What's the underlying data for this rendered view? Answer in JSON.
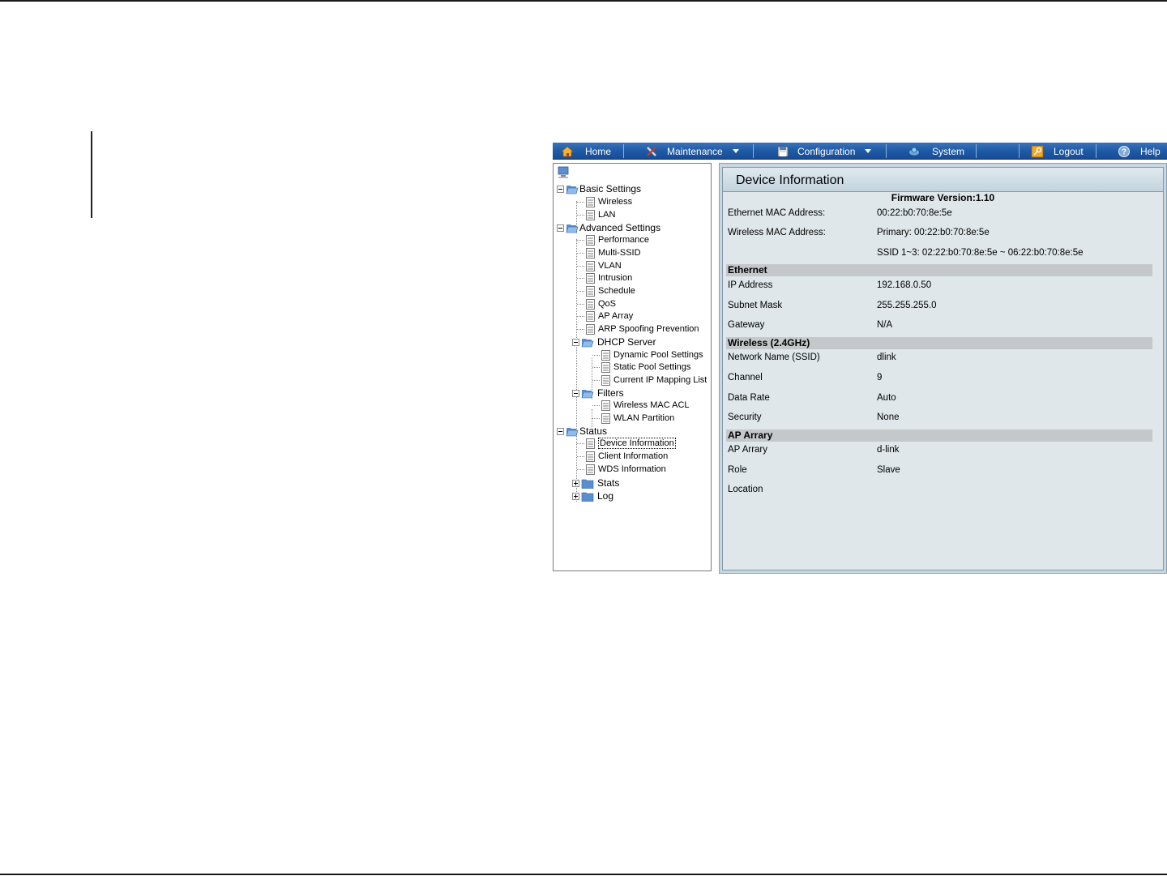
{
  "menu": {
    "home": "Home",
    "maintenance": "Maintenance",
    "configuration": "Configuration",
    "system": "System",
    "logout": "Logout",
    "help": "Help"
  },
  "tree": {
    "basic_settings": "Basic Settings",
    "wireless": "Wireless",
    "lan": "LAN",
    "advanced_settings": "Advanced Settings",
    "performance": "Performance",
    "multi_ssid": "Multi-SSID",
    "vlan": "VLAN",
    "intrusion": "Intrusion",
    "schedule": "Schedule",
    "qos": "QoS",
    "ap_array": "AP Array",
    "arp_spoofing": "ARP Spoofing Prevention",
    "dhcp_server": "DHCP Server",
    "dynamic_pool": "Dynamic Pool Settings",
    "static_pool": "Static Pool Settings",
    "ip_mapping": "Current IP Mapping List",
    "filters": "Filters",
    "wireless_mac_acl": "Wireless MAC ACL",
    "wlan_partition": "WLAN Partition",
    "status": "Status",
    "device_information": "Device Information",
    "client_information": "Client Information",
    "wds_information": "WDS Information",
    "stats": "Stats",
    "log": "Log"
  },
  "panel": {
    "title": "Device Information",
    "firmware": "Firmware Version:1.10",
    "ethernet_mac_label": "Ethernet MAC Address:",
    "ethernet_mac_value": "00:22:b0:70:8e:5e",
    "wireless_mac_label": "Wireless MAC Address:",
    "wireless_mac_primary": "Primary: 00:22:b0:70:8e:5e",
    "wireless_mac_ssid": "SSID 1~3: 02:22:b0:70:8e:5e ~ 06:22:b0:70:8e:5e",
    "ethernet_section": "Ethernet",
    "ip_label": "IP Address",
    "ip_value": "192.168.0.50",
    "subnet_label": "Subnet Mask",
    "subnet_value": "255.255.255.0",
    "gateway_label": "Gateway",
    "gateway_value": "N/A",
    "wireless_section": "Wireless (2.4GHz)",
    "ssid_label": "Network Name (SSID)",
    "ssid_value": "dlink",
    "channel_label": "Channel",
    "channel_value": "9",
    "rate_label": "Data Rate",
    "rate_value": "Auto",
    "security_label": "Security",
    "security_value": "None",
    "aparray_section": "AP Arrary",
    "aparray_label": "AP Arrary",
    "aparray_value": "d-link",
    "role_label": "Role",
    "role_value": "Slave",
    "location_label": "Location"
  }
}
